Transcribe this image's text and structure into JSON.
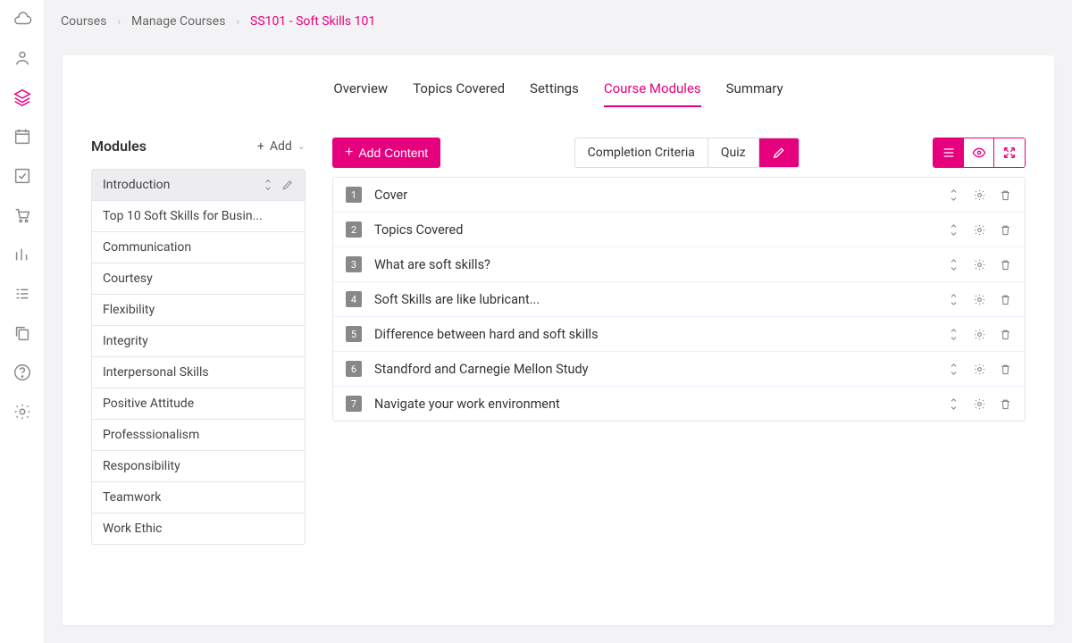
{
  "breadcrumb": {
    "items": [
      "Courses",
      "Manage Courses",
      "SS101 - Soft Skills 101"
    ],
    "active_index": 2
  },
  "tabs": {
    "items": [
      "Overview",
      "Topics Covered",
      "Settings",
      "Course Modules",
      "Summary"
    ],
    "active_index": 3
  },
  "modules": {
    "heading": "Modules",
    "add_label": "Add",
    "items": [
      "Introduction",
      "Top 10 Soft Skills for Busin...",
      "Communication",
      "Courtesy",
      "Flexibility",
      "Integrity",
      "Interpersonal Skills",
      "Positive Attitude",
      "Professsionalism",
      "Responsibility",
      "Teamwork",
      "Work Ethic"
    ],
    "active_index": 0
  },
  "toolbar": {
    "add_content": "Add Content",
    "segments": {
      "items": [
        "Completion Criteria",
        "Quiz",
        ""
      ],
      "icon_index": 2,
      "active_index": 2
    }
  },
  "view_modes": {
    "active_index": 0
  },
  "content_items": [
    {
      "n": "1",
      "title": "Cover"
    },
    {
      "n": "2",
      "title": "Topics Covered"
    },
    {
      "n": "3",
      "title": "What are soft skills?"
    },
    {
      "n": "4",
      "title": "Soft Skills are like lubricant..."
    },
    {
      "n": "5",
      "title": "Difference between hard and soft skills"
    },
    {
      "n": "6",
      "title": "Standford and Carnegie Mellon Study"
    },
    {
      "n": "7",
      "title": "Navigate your work environment"
    }
  ],
  "nav_rail": {
    "active_index": 2
  }
}
